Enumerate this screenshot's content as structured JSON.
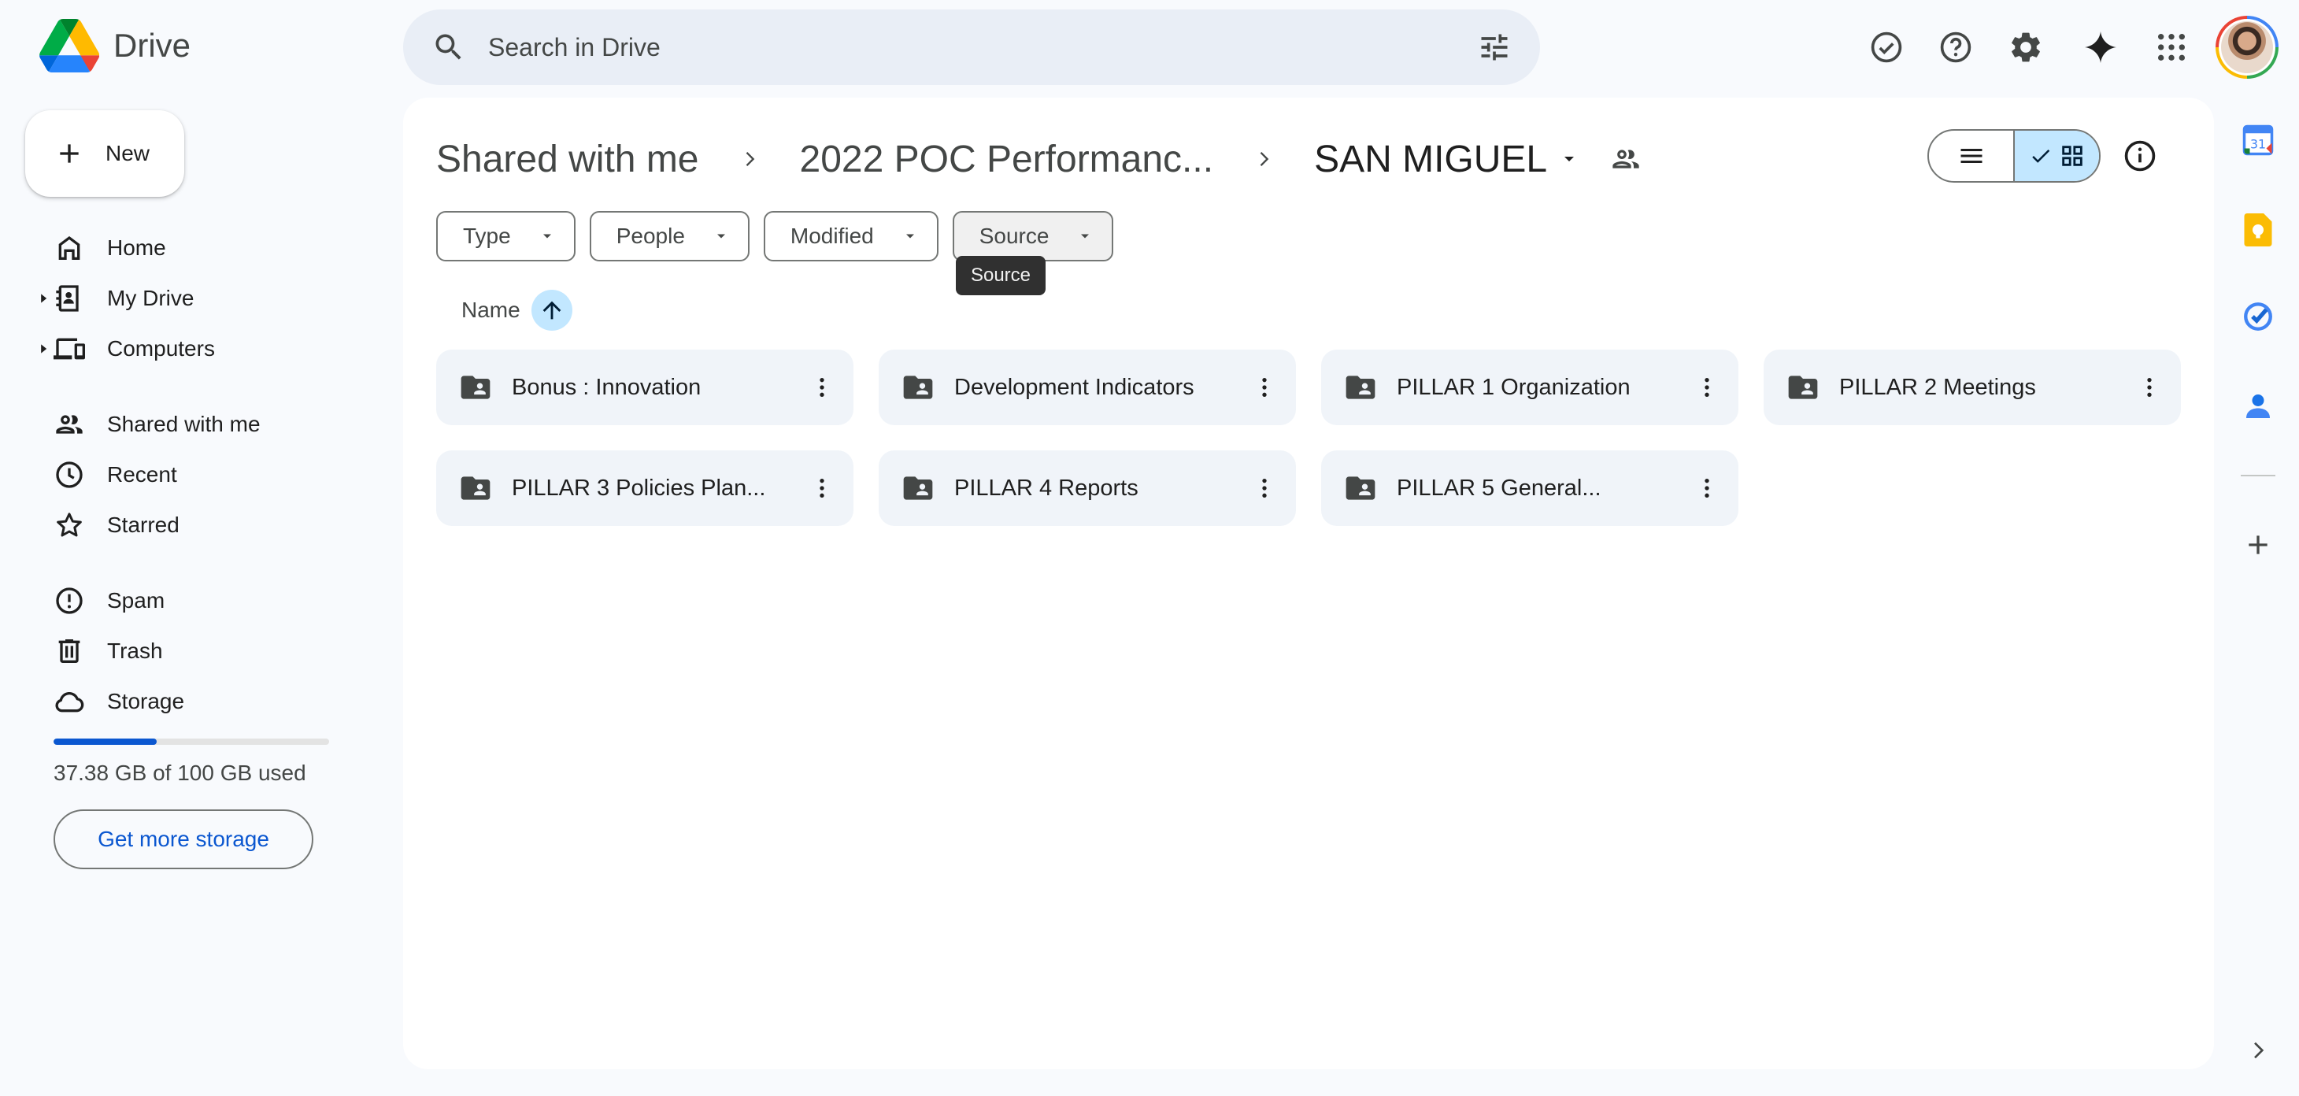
{
  "app": {
    "name": "Drive"
  },
  "search": {
    "placeholder": "Search in Drive"
  },
  "sidebar": {
    "new_label": "New",
    "items": [
      {
        "label": "Home"
      },
      {
        "label": "My Drive"
      },
      {
        "label": "Computers"
      },
      {
        "label": "Shared with me"
      },
      {
        "label": "Recent"
      },
      {
        "label": "Starred"
      },
      {
        "label": "Spam"
      },
      {
        "label": "Trash"
      },
      {
        "label": "Storage"
      }
    ],
    "storage": {
      "used_text": "37.38 GB of 100 GB used",
      "used_fraction": 0.3738,
      "cta": "Get more storage"
    }
  },
  "breadcrumb": {
    "items": [
      "Shared with me",
      "2022 POC Performanc..."
    ],
    "current": "SAN MIGUEL"
  },
  "filters": [
    "Type",
    "People",
    "Modified",
    "Source"
  ],
  "tooltip": "Source",
  "sort": {
    "label": "Name"
  },
  "folders": [
    "Bonus : Innovation",
    "Development Indicators",
    "PILLAR 1 Organization",
    "PILLAR 2 Meetings",
    "PILLAR 3 Policies Plan...",
    "PILLAR 4 Reports",
    "PILLAR 5 General..."
  ],
  "colors": {
    "accent": "#0b57d0",
    "selected": "#c2e7ff",
    "surface": "#f8fafd",
    "card": "#f0f4f9"
  }
}
